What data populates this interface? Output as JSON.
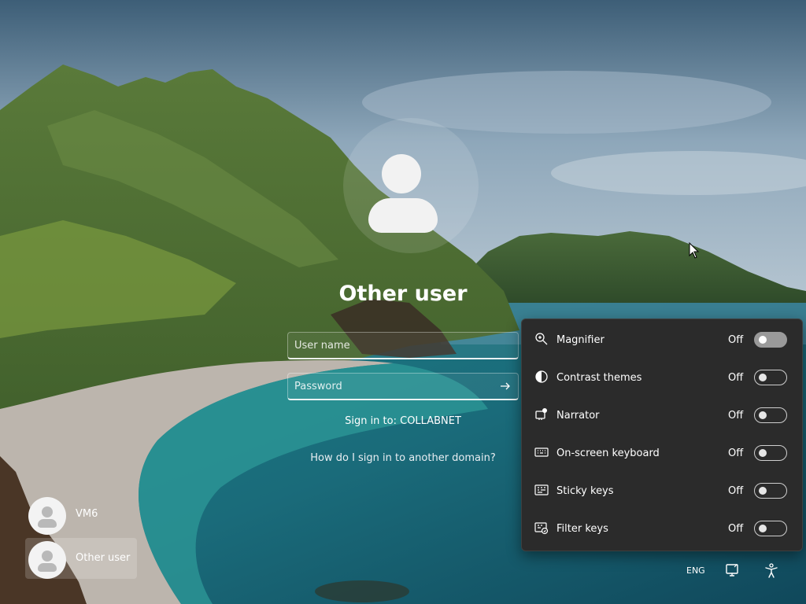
{
  "login": {
    "selected_user": "Other user",
    "username_placeholder": "User name",
    "password_placeholder": "Password",
    "sign_in_to": "Sign in to: COLLABNET",
    "other_domain_link": "How do I sign in to another domain?"
  },
  "users": [
    {
      "name": "VM6",
      "selected": false
    },
    {
      "name": "Other user",
      "selected": true
    }
  ],
  "accessibility": {
    "items": [
      {
        "label": "Magnifier",
        "state": "Off",
        "icon": "magnifier-icon"
      },
      {
        "label": "Contrast themes",
        "state": "Off",
        "icon": "contrast-icon"
      },
      {
        "label": "Narrator",
        "state": "Off",
        "icon": "narrator-icon"
      },
      {
        "label": "On-screen keyboard",
        "state": "Off",
        "icon": "keyboard-icon"
      },
      {
        "label": "Sticky keys",
        "state": "Off",
        "icon": "sticky-keys-icon"
      },
      {
        "label": "Filter keys",
        "state": "Off",
        "icon": "filter-keys-icon"
      }
    ]
  },
  "tray": {
    "language": "ENG",
    "network_icon": "network-icon",
    "accessibility_icon": "accessibility-icon"
  },
  "colors": {
    "panel_bg": "#2b2b2b",
    "text": "#ffffff",
    "toggle_hover": "#9a9a9a"
  }
}
